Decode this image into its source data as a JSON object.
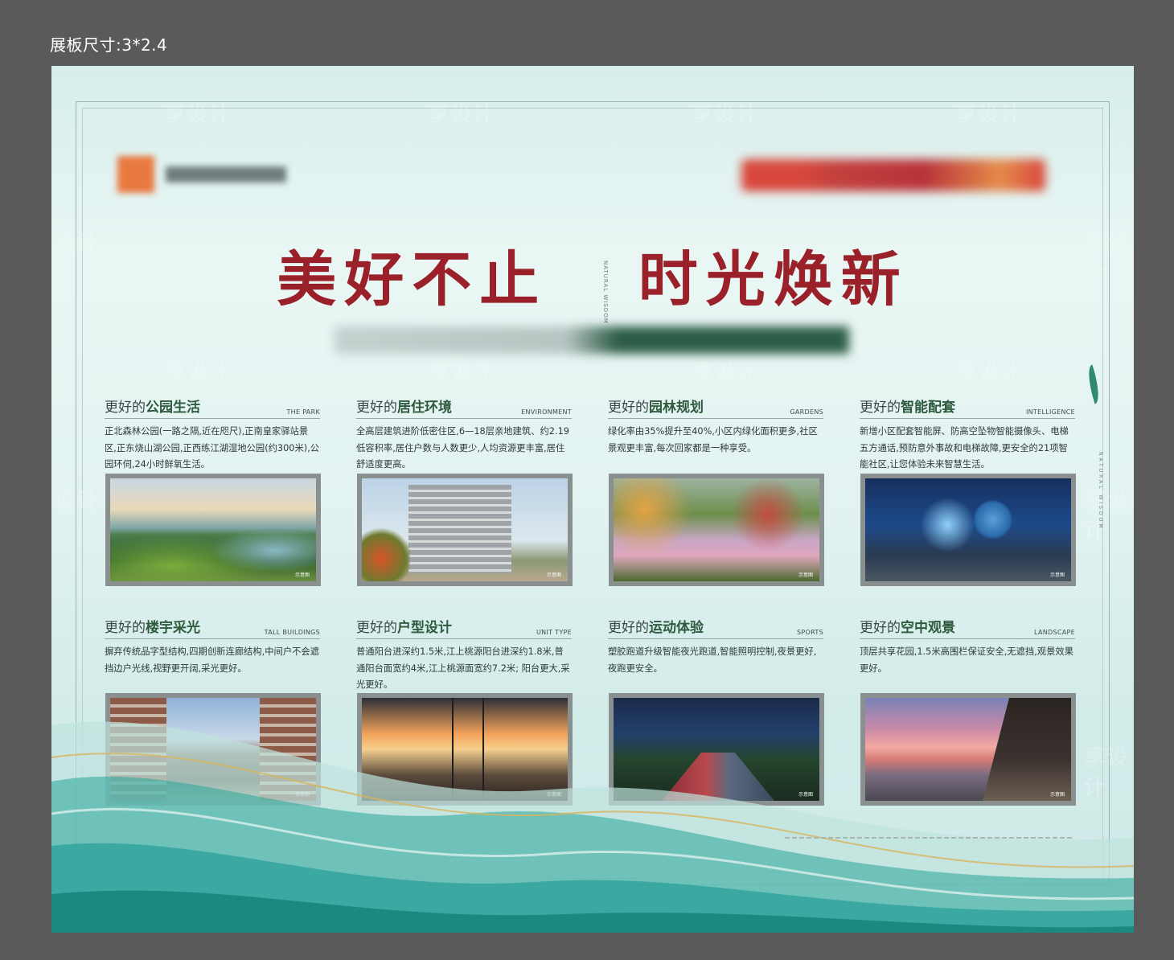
{
  "header_label": "展板尺寸:3*2.4",
  "headline": {
    "left": "美好不止",
    "right": "时光焕新",
    "separator": "NATURAL WISDOM"
  },
  "side_text": "NATURAL WISDOM",
  "watermark": "享设计",
  "photo_tag": "示意图",
  "cards": [
    {
      "prefix": "更好的",
      "title": "公园生活",
      "en": "THE PARK",
      "desc": "正北森林公园(一路之隔,近在咫尺),正南皇家驿站景区,正东烧山湖公园,正西练江湖湿地公园(约300米),公园环伺,24小时鲜氧生活。"
    },
    {
      "prefix": "更好的",
      "title": "居住环境",
      "en": "ENVIRONMENT",
      "desc": "全高层建筑进阶低密住区,6—18层亲地建筑、约2.19低容积率,居住户数与人数更少,人均资源更丰富,居住舒适度更高。"
    },
    {
      "prefix": "更好的",
      "title": "园林规划",
      "en": "GARDENS",
      "desc": "绿化率由35%提升至40%,小区内绿化面积更多,社区景观更丰富,每次回家都是一种享受。"
    },
    {
      "prefix": "更好的",
      "title": "智能配套",
      "en": "INTELLIGENCE",
      "desc": "新增小区配套智能屏、防高空坠物智能摄像头、电梯五方通话,预防意外事故和电梯故障,更安全的21项智能社区,让您体验未来智慧生活。"
    },
    {
      "prefix": "更好的",
      "title": "楼宇采光",
      "en": "TALL BUILDINGS",
      "desc": "摒弃传统品字型结构,四期创新连廊结构,中间户不会遮挡边户光线,视野更开阔,采光更好。"
    },
    {
      "prefix": "更好的",
      "title": "户型设计",
      "en": "UNIT TYPE",
      "desc": "普通阳台进深约1.5米,江上桃源阳台进深约1.8米,普通阳台面宽约4米,江上桃源面宽约7.2米; 阳台更大,采光更好。"
    },
    {
      "prefix": "更好的",
      "title": "运动体验",
      "en": "SPORTS",
      "desc": "塑胶跑道升级智能夜光跑道,智能照明控制,夜景更好,夜跑更安全。"
    },
    {
      "prefix": "更好的",
      "title": "空中观景",
      "en": "LANDSCAPE",
      "desc": "顶层共享花园,1.5米高围栏保证安全,无遮挡,观景效果更好。"
    }
  ],
  "colors": {
    "headline": "#9a2029",
    "title_accent": "#2e5a3e",
    "wave": "#1f9b93",
    "frame": "#9ab3b0"
  }
}
